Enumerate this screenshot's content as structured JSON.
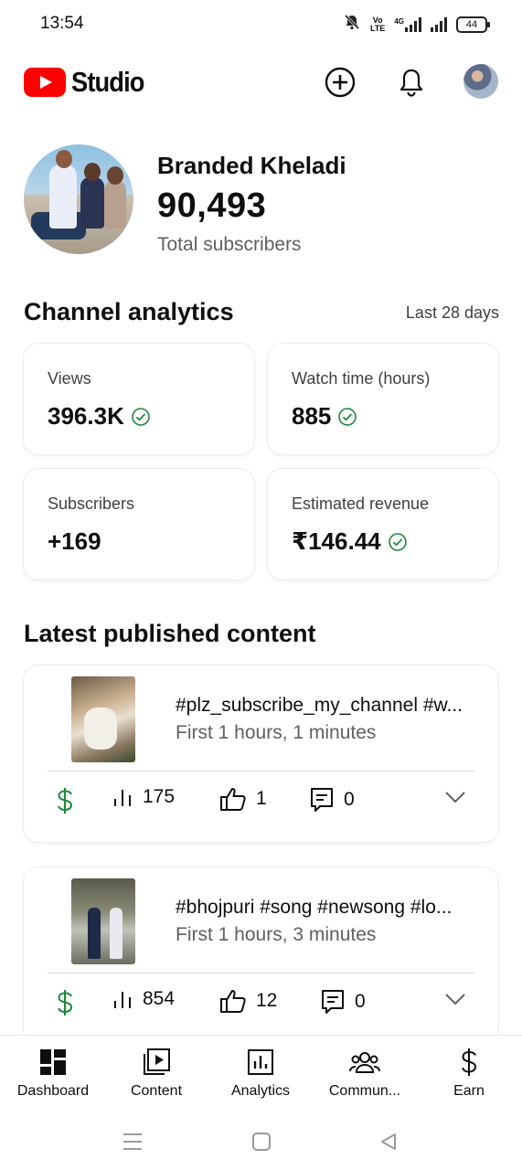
{
  "status_bar": {
    "time": "13:54",
    "network": "4G",
    "volte_line1": "Vo",
    "volte_line2": "LTE",
    "battery": "44"
  },
  "header": {
    "brand": "Studio",
    "icons": [
      "create-icon",
      "bell-icon",
      "account-avatar"
    ]
  },
  "profile": {
    "channel_name": "Branded Kheladi",
    "subscriber_count": "90,493",
    "subscriber_label": "Total subscribers"
  },
  "analytics": {
    "title": "Channel analytics",
    "range": "Last 28 days",
    "cards": [
      {
        "label": "Views",
        "value": "396.3K",
        "verified": true
      },
      {
        "label": "Watch time (hours)",
        "value": "885",
        "verified": true
      },
      {
        "label": "Subscribers",
        "value": "+169",
        "verified": false
      },
      {
        "label": "Estimated revenue",
        "value": "₹146.44",
        "verified": true
      }
    ]
  },
  "latest": {
    "title": "Latest published content",
    "items": [
      {
        "title": "#plz_subscribe_my_channel #w...",
        "time": "First 1 hours, 1 minutes",
        "views": "175",
        "likes": "1",
        "comments": "0"
      },
      {
        "title": "#bhojpuri #song #newsong #lo...",
        "time": "First 1 hours, 3 minutes",
        "views": "854",
        "likes": "12",
        "comments": "0"
      }
    ]
  },
  "bottom_nav": {
    "items": [
      {
        "label": "Dashboard",
        "icon": "dashboard-icon"
      },
      {
        "label": "Content",
        "icon": "content-icon"
      },
      {
        "label": "Analytics",
        "icon": "analytics-icon"
      },
      {
        "label": "Commun...",
        "icon": "community-icon"
      },
      {
        "label": "Earn",
        "icon": "earn-icon"
      }
    ]
  },
  "colors": {
    "brand_red": "#ff0000",
    "verified_green": "#1d8a3a",
    "text_primary": "#0f0f0f",
    "text_secondary": "#606060"
  }
}
